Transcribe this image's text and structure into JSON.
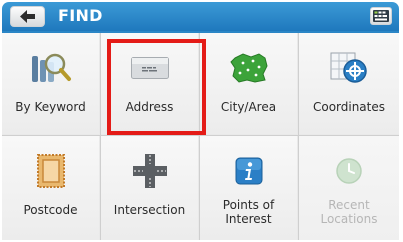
{
  "header": {
    "title": "FIND",
    "back_icon": "left-arrow-icon",
    "keyboard_icon": "keyboard-icon",
    "color": "#2a86c8"
  },
  "grid": {
    "row1": [
      {
        "label": "By Keyword",
        "icon": "keyword-magnifier-icon"
      },
      {
        "label": "Address",
        "icon": "address-card-icon"
      },
      {
        "label": "City/Area",
        "icon": "city-area-map-icon"
      },
      {
        "label": "Coordinates",
        "icon": "coordinates-globe-icon"
      }
    ],
    "row2": [
      {
        "label": "Postcode",
        "icon": "postcode-stamp-icon"
      },
      {
        "label": "Intersection",
        "icon": "intersection-icon"
      },
      {
        "label_line1": "Points of",
        "label_line2": "Interest",
        "icon": "info-icon"
      },
      {
        "label_line1": "Recent",
        "label_line2": "Locations",
        "icon": "clock-icon",
        "disabled": true
      }
    ]
  },
  "selection": {
    "highlighted": "Address",
    "highlight_color": "#e41b17"
  }
}
